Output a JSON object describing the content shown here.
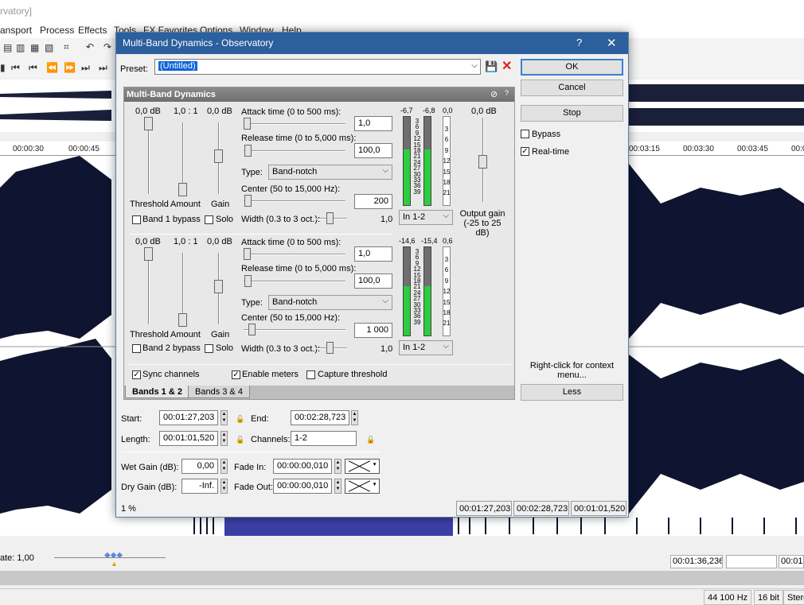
{
  "bg": {
    "title_fragment": "rvatory]",
    "menu": [
      "ansport",
      "Process",
      "Effects",
      "Tools",
      "FX Favorites",
      "Options",
      "Window",
      "Help"
    ],
    "ruler": [
      "00:00:30",
      "00:00:45",
      "00:03:15",
      "00:03:30",
      "00:03:45",
      "00:0"
    ],
    "rate_label": "ate: 1,00",
    "cursor_time": "00:01:36,236",
    "cursor_time2": "00:01",
    "status": [
      "44 100 Hz",
      "16 bit",
      "Stere"
    ]
  },
  "dialog": {
    "title": "Multi-Band Dynamics - Observatory",
    "help": "?",
    "close": "✕",
    "preset_label": "Preset:",
    "preset_value": "(Untitled)",
    "ok": "OK",
    "cancel": "Cancel",
    "stop": "Stop",
    "bypass": "Bypass",
    "realtime": "Real-time",
    "context_hint": "Right-click for context menu...",
    "less": "Less",
    "plugin_title": "Multi-Band Dynamics",
    "band1": {
      "threshold_val": "0,0 dB",
      "amount_val": "1,0 : 1",
      "gain_val": "0,0 dB",
      "attack_label": "Attack time (0 to 500 ms):",
      "attack_val": "1,0",
      "release_label": "Release time (0 to 5,000 ms):",
      "release_val": "100,0",
      "type_label": "Type:",
      "type_val": "Band-notch",
      "center_label": "Center (50 to 15,000 Hz):",
      "center_val": "200",
      "width_label": "Width (0.3 to 3 oct.):",
      "width_val": "1,0",
      "route": "In 1-2",
      "threshold": "Threshold",
      "amount": "Amount",
      "gain": "Gain",
      "bypass": "Band 1 bypass",
      "solo": "Solo",
      "meter_peaks": [
        "-6,7",
        "-6,8",
        "0,0"
      ]
    },
    "band2": {
      "threshold_val": "0,0 dB",
      "amount_val": "1,0 : 1",
      "gain_val": "0,0 dB",
      "attack_label": "Attack time (0 to 500 ms):",
      "attack_val": "1,0",
      "release_label": "Release time (0 to 5,000 ms):",
      "release_val": "100,0",
      "type_label": "Type:",
      "type_val": "Band-notch",
      "center_label": "Center (50 to 15,000 Hz):",
      "center_val": "1 000",
      "width_label": "Width (0.3 to 3 oct.):",
      "width_val": "1,0",
      "route": "In 1-2",
      "threshold": "Threshold",
      "amount": "Amount",
      "gain": "Gain",
      "bypass": "Band 2 bypass",
      "solo": "Solo",
      "meter_peaks": [
        "-14,6",
        "-15,4",
        "0,6"
      ]
    },
    "meter_scale": "3\n6\n9\n12\n15\n18\n21\n24\n27\n30\n33\n36\n39",
    "gain_scale": "3\n6\n9\n12\n15\n18\n21",
    "output_val": "0,0 dB",
    "output_label": "Output gain (-25 to 25 dB)",
    "sync": "Sync channels",
    "enable_meters": "Enable meters",
    "capture": "Capture threshold",
    "tab1": "Bands 1 & 2",
    "tab2": "Bands 3 & 4",
    "start_label": "Start:",
    "start_val": "00:01:27,203",
    "end_label": "End:",
    "end_val": "00:02:28,723",
    "length_label": "Length:",
    "length_val": "00:01:01,520",
    "channels_label": "Channels:",
    "channels_val": "1-2",
    "wet_label": "Wet Gain (dB):",
    "wet_val": "0,00",
    "dry_label": "Dry Gain (dB):",
    "dry_val": "-Inf.",
    "fadein_label": "Fade In:",
    "fadein_val": "00:00:00,010",
    "fadeout_label": "Fade Out:",
    "fadeout_val": "00:00:00,010",
    "progress": "1 %",
    "sb_start": "00:01:27,203",
    "sb_end": "00:02:28,723",
    "sb_len": "00:01:01,520"
  }
}
